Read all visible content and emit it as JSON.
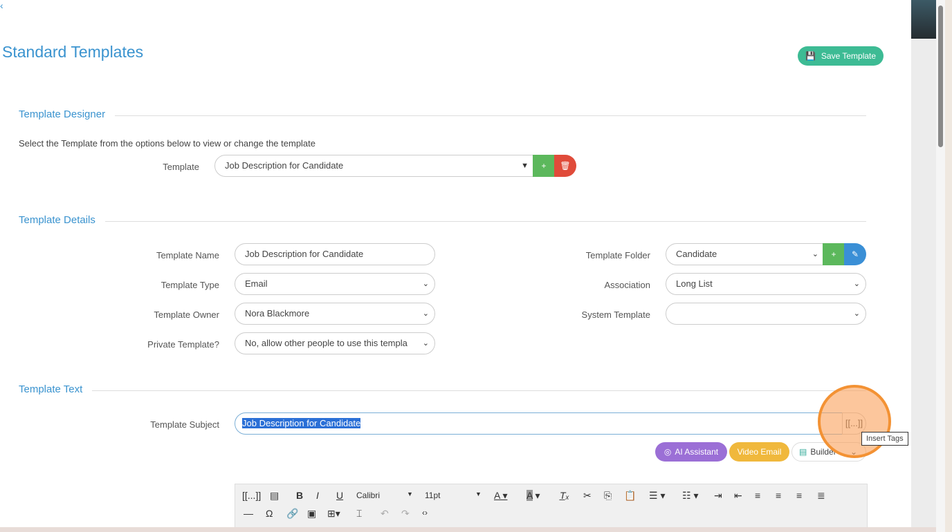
{
  "page": {
    "title": "Standard Templates",
    "save_label": "Save Template"
  },
  "designer": {
    "heading": "Template Designer",
    "instructions": "Select the Template from the options below to view or change the template",
    "template_label": "Template",
    "template_value": "Job Description for Candidate"
  },
  "details": {
    "heading": "Template Details",
    "name_label": "Template Name",
    "name_value": "Job Description for Candidate",
    "type_label": "Template Type",
    "type_value": "Email",
    "owner_label": "Template Owner",
    "owner_value": "Nora Blackmore",
    "private_label": "Private Template?",
    "private_value": "No, allow other people to use this templa",
    "folder_label": "Template Folder",
    "folder_value": "Candidate",
    "assoc_label": "Association",
    "assoc_value": "Long List",
    "system_label": "System Template",
    "system_value": ""
  },
  "text": {
    "heading": "Template Text",
    "subject_label": "Template Subject",
    "subject_value": "Job Description for Candidate",
    "insert_tags": "[[...]]",
    "tooltip": "Insert Tags",
    "ai_label": "AI Assistant",
    "video_label": "Video Email",
    "builder_label": "Builder"
  },
  "toolbar": {
    "tags": "[[...]]",
    "font": "Calibri",
    "size": "11pt",
    "bold": "B",
    "italic": "I",
    "underline": "U"
  },
  "colors": {
    "accent": "#3a93cf",
    "save": "#3dbb94",
    "green": "#5cb85c",
    "red": "#e04b3a",
    "blue": "#3a8fd6",
    "ai": "#9b6fd6",
    "video": "#f0b83c"
  }
}
